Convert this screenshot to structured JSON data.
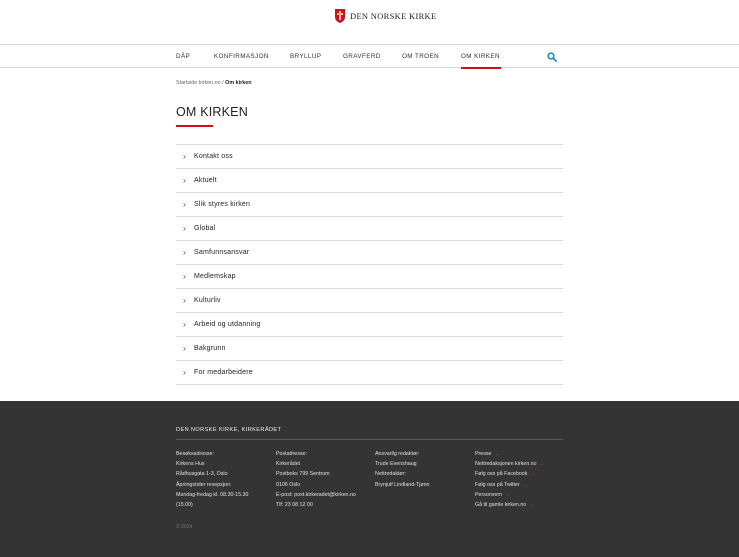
{
  "header": {
    "logo_text": "DEN NORSKE KIRKE"
  },
  "nav": {
    "items": [
      {
        "label": "DÅP"
      },
      {
        "label": "KONFIRMASJON"
      },
      {
        "label": "BRYLLUP"
      },
      {
        "label": "GRAVFERD"
      },
      {
        "label": "OM TROEN"
      },
      {
        "label": "OM KIRKEN",
        "active": true
      }
    ]
  },
  "breadcrumb": {
    "home": "Startside kirken.no",
    "separator": "/",
    "current": "Om kirken"
  },
  "page": {
    "title": "OM KIRKEN"
  },
  "menu": {
    "items": [
      "Kontakt oss",
      "Aktuelt",
      "Slik styres kirken",
      "Global",
      "Samfunnsansvar",
      "Medlemskap",
      "Kulturliv",
      "Arbeid og utdanning",
      "Bakgrunn",
      "For medarbeidere"
    ]
  },
  "footer": {
    "title": "DEN NORSKE KIRKE, KIRKERÅDET",
    "col1": [
      "Besøksadresse:",
      "Kirkens Hus",
      "Rådhusgata 1-3, Oslo",
      "Åpningstider resepsjon:",
      "Mandag-fredag kl. 08.30-15.30",
      "(15.00)"
    ],
    "col2": [
      "Postadresse:",
      "Kirkerådet",
      "Postboks 799 Sentrum",
      "0106 Oslo",
      "E-post: post.kirkeradet@kirken.no",
      "Tlf: 23 08 12 00"
    ],
    "col3": [
      "Ansvarlig redaktør:",
      "Trude Evenshaug",
      "Nettredaktør:",
      "Brynjulf Lindland-Tjønn"
    ],
    "links": [
      "Presse",
      "Nettredaksjonen kirken.no",
      "Følg oss på Facebook",
      "Følg oss på Twitter",
      "Personvern",
      "Gå til gamle kirken.no"
    ],
    "copyright": "© 2014"
  },
  "colors": {
    "accent": "#d00e1f",
    "footer_bg": "#343434",
    "search_icon": "#1b8ac6"
  },
  "icons": {
    "logo": "church-shield-icon",
    "search": "search-icon",
    "menu_chevron": "chevron-right-icon",
    "footer_link": "arrow-right-icon"
  }
}
